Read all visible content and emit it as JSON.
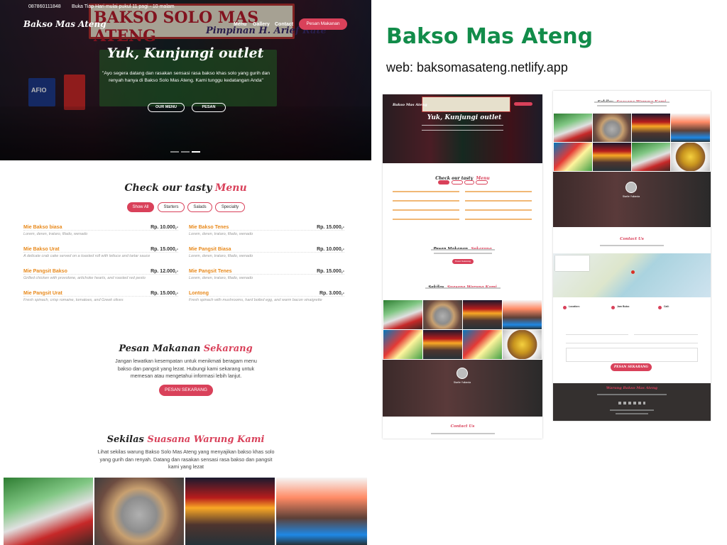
{
  "colors": {
    "accent": "#d9415a",
    "brand_green": "#128c4a",
    "menu_item": "#e8891b"
  },
  "topbar": {
    "phone": "087860111848",
    "hours": "Buka Tiap Hari mulai pukul 11 pagi - 10 malam"
  },
  "nav": {
    "logo": "Bakso Mas Ateng",
    "items": [
      "Menu",
      "Gallery",
      "Contact"
    ],
    "cta": "Pesan Makanan"
  },
  "hero": {
    "title": "Yuk, Kunjungi outlet",
    "text": "\"Ayo segera datang dan rasakan sensasi rasa bakso khas solo yang gurih dan renyah hanya di Bakso Solo Mas Ateng. Kami tunggu kedatangan Anda\"",
    "btn_menu": "OUR MENU",
    "btn_order": "PESAN",
    "sign_text": "BAKSO SOLO MAS ATENG",
    "sign_sub": "Pimpinan H. Arief Rate",
    "sign_left": "AFIO"
  },
  "menu": {
    "title_a": "Check our tasty",
    "title_b": "Menu",
    "filters": [
      "Show All",
      "Starters",
      "Salads",
      "Specialty"
    ],
    "items": [
      {
        "name": "Mie Bakso biasa",
        "desc": "Lorem, deren, trataro, filado, wenado",
        "price": "Rp. 10.000,-"
      },
      {
        "name": "Mie Bakso Tenes",
        "desc": "Lorem, deren, trataro, filado, wenado",
        "price": "Rp. 15.000,-"
      },
      {
        "name": "Mie Bakso Urat",
        "desc": "A delicate crab cake served on a toasted roll with lettuce and tartar sauce",
        "price": "Rp. 15.000,-"
      },
      {
        "name": "Mie Pangsit Biasa",
        "desc": "Lorem, deren, trataro, filado, wenado",
        "price": "Rp. 10.000,-"
      },
      {
        "name": "Mie Pangsit Bakso",
        "desc": "Grilled chicken with provolone, artichoke hearts, and roasted red pesto",
        "price": "Rp. 12.000,-"
      },
      {
        "name": "Mie Pangsit Tenes",
        "desc": "Lorem, deren, trataro, filado, wenado",
        "price": "Rp. 15.000,-"
      },
      {
        "name": "Mie Pangsit Urat",
        "desc": "Fresh spinach, crisp romaine, tomatoes, and Greek olives",
        "price": "Rp. 15.000,-"
      },
      {
        "name": "Lontong",
        "desc": "Fresh spinach with mushrooms, hard boiled egg, and warm bacon vinaigrette",
        "price": "Rp. 3.000,-"
      }
    ]
  },
  "order": {
    "title_a": "Pesan Makanan",
    "title_b": "Sekarang",
    "text": "Jangan lewatkan kesempatan untuk menikmati beragam menu bakso dan pangsit yang lezat. Hubungi kami sekarang untuk memesan atau mengetahui informasi lebih lanjut.",
    "button": "PESAN SEKARANG"
  },
  "gallery": {
    "title_a": "Sekilas",
    "title_b": "Suasana Warung Kami",
    "text": "Lihat sekilas warung Bakso Solo Mas Ateng yang menyajikan bakso khas solo yang gurih dan renyah. Datang dan rasakan sensasi rasa bakso dan pangsit kami yang lezat"
  },
  "brand": {
    "title": "Bakso Mas Ateng",
    "web": "web: baksomasateng.netlify.app"
  },
  "thumbs": {
    "menu_title_a": "Check our tasty",
    "menu_title_b": "Menu",
    "order_title_a": "Pesan Makanan",
    "order_title_b": "Sekarang",
    "order_btn": "Pesan Sekarang",
    "gallery_title_a": "Sekilas",
    "gallery_title_b": "Suasana Warung Kami",
    "contact_title": "Contact Us",
    "testimonial_name": "Starlie Yulianda",
    "contact_cards": [
      "Location:",
      "Jam Buka:",
      "Call:"
    ],
    "form_btn": "PESAN SEKARANG",
    "footer_title": "Warung Bakso Mas Ateng"
  }
}
